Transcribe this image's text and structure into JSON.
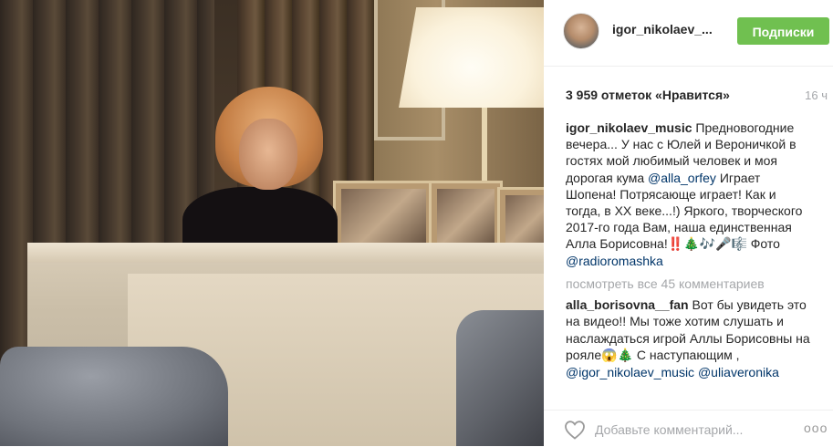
{
  "post": {
    "author": "igor_nikolaev_...",
    "follow_label": "Подписки",
    "likes_text": "3 959 отметок «Нравится»",
    "time_ago": "16 ч",
    "caption": {
      "username": "igor_nikolaev_music",
      "text_1": " Предновогодние вечера... У нас с Юлей и Вероничкой в гостях мой любимый человек и моя дорогая кума ",
      "mention_1": "@alla_orfey",
      "text_2": " Играет Шопена! Потрясающе играет! Как и тогда, в ХХ веке...!) Яркого, творческого 2017-го года Вам, наша единственная Алла Борисовна!‼️🎄🎶🎤🎼 Фото ",
      "mention_2": "@radioromashka"
    },
    "view_all_comments": "посмотреть все 45 комментариев",
    "comment": {
      "username": "alla_borisovna__fan",
      "text": " Вот бы увидеть это на видео!! Мы тоже хотим слушать и наслаждаться игрой Аллы Борисовны на рояле😱🎄 С наступающим , ",
      "mention_1": "@igor_nikolaev_music",
      "separator": " ",
      "mention_2": "@uliaveronika"
    },
    "add_comment_placeholder": "Добавьте комментарий...",
    "more_label": "ooo"
  },
  "colors": {
    "follow_button": "#70c050",
    "mention": "#003569",
    "muted": "#a5a7aa"
  },
  "icons": {
    "like": "heart-outline-icon",
    "options": "more-options-icon"
  }
}
